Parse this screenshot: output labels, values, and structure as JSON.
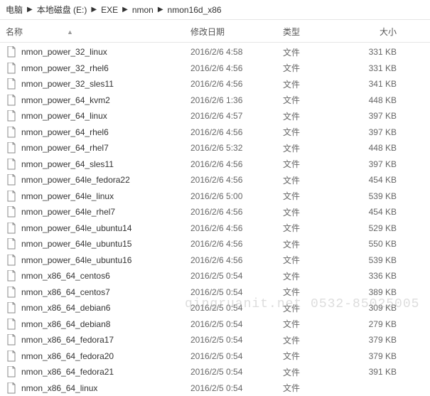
{
  "breadcrumb": {
    "items": [
      "电脑",
      "本地磁盘 (E:)",
      "EXE",
      "nmon",
      "nmon16d_x86"
    ]
  },
  "columns": {
    "name": "名称",
    "date": "修改日期",
    "type": "类型",
    "size": "大小"
  },
  "watermark": "qingruanit.net 0532-85025005",
  "files": [
    {
      "name": "nmon_power_32_linux",
      "date": "2016/2/6 4:58",
      "type": "文件",
      "size": "331 KB"
    },
    {
      "name": "nmon_power_32_rhel6",
      "date": "2016/2/6 4:56",
      "type": "文件",
      "size": "331 KB"
    },
    {
      "name": "nmon_power_32_sles11",
      "date": "2016/2/6 4:56",
      "type": "文件",
      "size": "341 KB"
    },
    {
      "name": "nmon_power_64_kvm2",
      "date": "2016/2/6 1:36",
      "type": "文件",
      "size": "448 KB"
    },
    {
      "name": "nmon_power_64_linux",
      "date": "2016/2/6 4:57",
      "type": "文件",
      "size": "397 KB"
    },
    {
      "name": "nmon_power_64_rhel6",
      "date": "2016/2/6 4:56",
      "type": "文件",
      "size": "397 KB"
    },
    {
      "name": "nmon_power_64_rhel7",
      "date": "2016/2/6 5:32",
      "type": "文件",
      "size": "448 KB"
    },
    {
      "name": "nmon_power_64_sles11",
      "date": "2016/2/6 4:56",
      "type": "文件",
      "size": "397 KB"
    },
    {
      "name": "nmon_power_64le_fedora22",
      "date": "2016/2/6 4:56",
      "type": "文件",
      "size": "454 KB"
    },
    {
      "name": "nmon_power_64le_linux",
      "date": "2016/2/6 5:00",
      "type": "文件",
      "size": "539 KB"
    },
    {
      "name": "nmon_power_64le_rhel7",
      "date": "2016/2/6 4:56",
      "type": "文件",
      "size": "454 KB"
    },
    {
      "name": "nmon_power_64le_ubuntu14",
      "date": "2016/2/6 4:56",
      "type": "文件",
      "size": "529 KB"
    },
    {
      "name": "nmon_power_64le_ubuntu15",
      "date": "2016/2/6 4:56",
      "type": "文件",
      "size": "550 KB"
    },
    {
      "name": "nmon_power_64le_ubuntu16",
      "date": "2016/2/6 4:56",
      "type": "文件",
      "size": "539 KB"
    },
    {
      "name": "nmon_x86_64_centos6",
      "date": "2016/2/5 0:54",
      "type": "文件",
      "size": "336 KB"
    },
    {
      "name": "nmon_x86_64_centos7",
      "date": "2016/2/5 0:54",
      "type": "文件",
      "size": "389 KB"
    },
    {
      "name": "nmon_x86_64_debian6",
      "date": "2016/2/5 0:54",
      "type": "文件",
      "size": "309 KB"
    },
    {
      "name": "nmon_x86_64_debian8",
      "date": "2016/2/5 0:54",
      "type": "文件",
      "size": "279 KB"
    },
    {
      "name": "nmon_x86_64_fedora17",
      "date": "2016/2/5 0:54",
      "type": "文件",
      "size": "379 KB"
    },
    {
      "name": "nmon_x86_64_fedora20",
      "date": "2016/2/5 0:54",
      "type": "文件",
      "size": "379 KB"
    },
    {
      "name": "nmon_x86_64_fedora21",
      "date": "2016/2/5 0:54",
      "type": "文件",
      "size": "391 KB"
    },
    {
      "name": "nmon_x86_64_linux",
      "date": "2016/2/5 0:54",
      "type": "文件",
      "size": ""
    }
  ]
}
